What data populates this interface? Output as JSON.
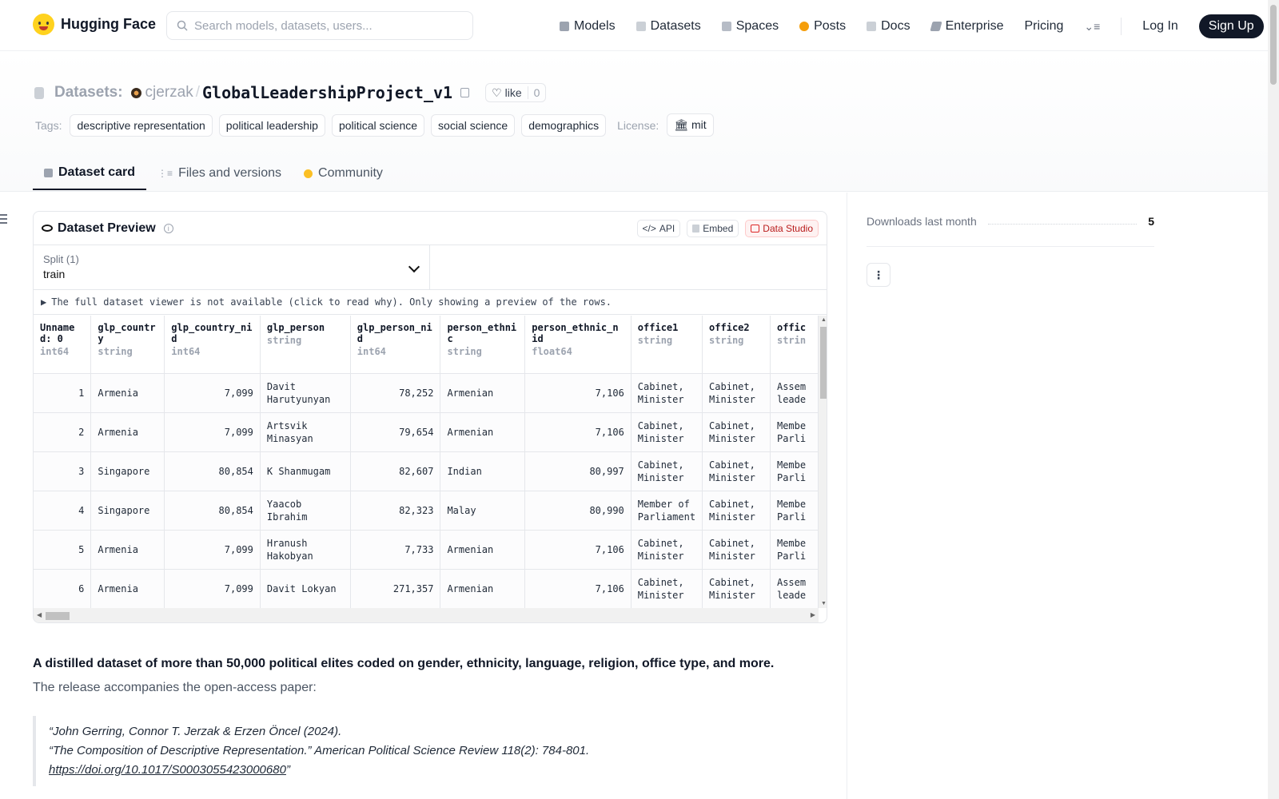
{
  "nav": {
    "logo_text": "Hugging Face",
    "search_placeholder": "Search models, datasets, users...",
    "links": [
      {
        "label": "Models",
        "icon": "cube-icon",
        "color": "#9ca3af"
      },
      {
        "label": "Datasets",
        "icon": "database-icon",
        "color": "#9ca3af"
      },
      {
        "label": "Spaces",
        "icon": "grid-icon",
        "color": "#9ca3af"
      },
      {
        "label": "Posts",
        "icon": "posts-icon",
        "color": "#f59e0b"
      },
      {
        "label": "Docs",
        "icon": "book-icon",
        "color": "#9ca3af"
      },
      {
        "label": "Enterprise",
        "icon": "enterprise-icon",
        "color": "#9ca3af"
      }
    ],
    "pricing": "Pricing",
    "login": "Log In",
    "signup": "Sign Up"
  },
  "header": {
    "section": "Datasets:",
    "user": "cjerzak",
    "slash": "/",
    "dataset_name": "GlobalLeadershipProject_v1",
    "like_label": "like",
    "like_count": "0",
    "tags_label": "Tags:",
    "tags": [
      "descriptive representation",
      "political leadership",
      "political science",
      "social science",
      "demographics"
    ],
    "license_label": "License:",
    "license": "mit"
  },
  "tabs": [
    {
      "label": "Dataset card",
      "icon": "cube-icon",
      "active": true
    },
    {
      "label": "Files and versions",
      "icon": "files-icon",
      "active": false
    },
    {
      "label": "Community",
      "icon": "community-icon",
      "active": false
    }
  ],
  "preview": {
    "title": "Dataset Preview",
    "info": "i",
    "api_label": "API",
    "embed_label": "Embed",
    "studio_label": "Data Studio",
    "split_label": "Split (1)",
    "split_value": "train",
    "notice": "The full dataset viewer is not available (click to read why). Only showing a preview of the rows.",
    "columns": [
      {
        "name": "Unnamed: 0",
        "type": "int64"
      },
      {
        "name": "glp_country",
        "type": "string"
      },
      {
        "name": "glp_country_nid",
        "type": "int64"
      },
      {
        "name": "glp_person",
        "type": "string"
      },
      {
        "name": "glp_person_nid",
        "type": "int64"
      },
      {
        "name": "person_ethnic",
        "type": "string"
      },
      {
        "name": "person_ethnic_nid",
        "type": "float64"
      },
      {
        "name": "office1",
        "type": "string"
      },
      {
        "name": "office2",
        "type": "string"
      },
      {
        "name": "offic",
        "type": "strin"
      }
    ],
    "rows": [
      [
        "1",
        "Armenia",
        "7,099",
        "Davit Harutyunyan",
        "78,252",
        "Armenian",
        "7,106",
        "Cabinet, Minister",
        "Cabinet, Minister",
        "Assem leade"
      ],
      [
        "2",
        "Armenia",
        "7,099",
        "Artsvik Minasyan",
        "79,654",
        "Armenian",
        "7,106",
        "Cabinet, Minister",
        "Cabinet, Minister",
        "Membe Parli"
      ],
      [
        "3",
        "Singapore",
        "80,854",
        "K Shanmugam",
        "82,607",
        "Indian",
        "80,997",
        "Cabinet, Minister",
        "Cabinet, Minister",
        "Membe Parli"
      ],
      [
        "4",
        "Singapore",
        "80,854",
        "Yaacob Ibrahim",
        "82,323",
        "Malay",
        "80,990",
        "Member of Parliament",
        "Cabinet, Minister",
        "Membe Parli"
      ],
      [
        "5",
        "Armenia",
        "7,099",
        "Hranush Hakobyan",
        "7,733",
        "Armenian",
        "7,106",
        "Cabinet, Minister",
        "Cabinet, Minister",
        "Membe Parli"
      ],
      [
        "6",
        "Armenia",
        "7,099",
        "Davit Lokyan",
        "271,357",
        "Armenian",
        "7,106",
        "Cabinet, Minister",
        "Cabinet, Minister",
        "Assem leade"
      ]
    ]
  },
  "sidebar": {
    "downloads_label": "Downloads last month",
    "downloads_value": "5"
  },
  "card": {
    "lead": "A distilled dataset of more than 50,000 political elites coded on gender, ethnicity, language, religion, office type, and more.",
    "para": "The release accompanies the open-access paper:",
    "quote_line1": "“John Gerring, Connor T. Jerzak & Erzen Öncel (2024).",
    "quote_line2": "“The Composition of Descriptive Representation.” American Political Science Review 118(2): 784-801.",
    "quote_link": "https://doi.org/10.1017/S0003055423000680",
    "quote_end": "”"
  }
}
